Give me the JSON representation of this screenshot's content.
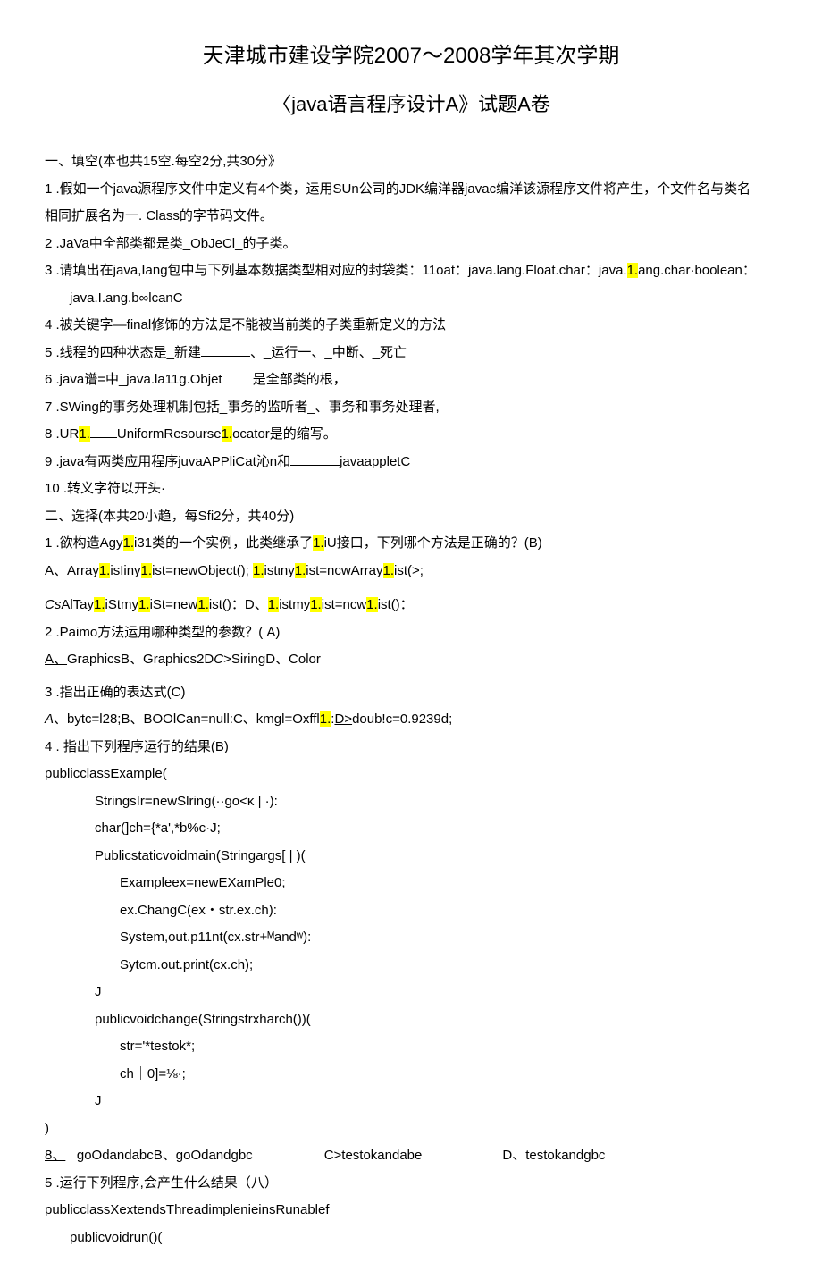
{
  "title1": "天津城市建设学院2007～2008学年其次学期",
  "title2": "〈java语言程序设计A》试题A卷",
  "sectionA": "一、填空(本也共15空.每空2分,共30分》",
  "q1a": "1 .假如一个java源程序文件中定义有4个类，运用SUn公司的JDK编洋器javac编洋该源程序文件将产生，个文件名与类名",
  "q1b": "相同扩展名为一. Class的字节码文件。",
  "q2": "2  .JaVa中全部类都是类_ObJeCl_的子类。",
  "q3a": "3  .请填出在java,Iang包中与下列基本数据类型相对应的封袋类：11oat：java.lang.Float.char：java.",
  "q3a_hl": "1.",
  "q3a_2": "ang.char·boolean：",
  "q3b": "java.I.ang.b∞lcanC",
  "q4": "4  .被关键字—final修饰的方法是不能被当前类的子类重新定义的方法",
  "q5": "5  .线程的四种状态是_新建",
  "q5b": "、_运行一、_中断、_死亡",
  "q6a": "6  .java谱=中_java.la11g.Objet  ",
  "q6b": "是全部类的根，",
  "q7": "7  .SWing的事务处理机制包括_事务的监听者_、事务和事务处理者,",
  "q8a": "8  .UR",
  "q8hl1": "1.",
  "q8b": "UniformResourse",
  "q8hl2": "1.",
  "q8c": "ocator是的缩写。",
  "q9a": "9  .java有两类应用程序juvaAPPliCat沁n和",
  "q9b": "javaappletC",
  "q10": "10   .转义字符以开头·",
  "sectionB": "二、选择(本共20小趋，每Sfi2分，共40分)",
  "b1a": "1 .欲构造Agy",
  "b1hl1": "1.",
  "b1b": "i31类的一个实例，此类继承了",
  "b1hl2": "1.",
  "b1c": "iU接口，下列哪个方法是正确的？(B)",
  "b1ansA": "A、Array",
  "b1ah1": "1.",
  "b1ansA2": "isIiny",
  "b1ah2": "1.",
  "b1ansA3": "ist=newObject(); ",
  "b1ah3": "1.",
  "b1ansA4": "istιny",
  "b1ah4": "1.",
  "b1ansA5": "ist=ncwArray",
  "b1ah5": "1.",
  "b1ansA6": "ist(>;",
  "b1ansC_pre": "Cs",
  "b1ansC1": "AlTay",
  "b1ch1": "1.",
  "b1ansC2": "iStmy",
  "b1ch2": "1.",
  "b1ansC3": "iSt=new",
  "b1ch3": "1.",
  "b1ansC4": "ist()：D、",
  "b1ch4": "1.",
  "b1ansC5": "istmy",
  "b1ch5": "1.",
  "b1ansC6": "ist=ncw",
  "b1ch6": "1.",
  "b1ansC7": "ist()：",
  "b2": "2  .Paimo方法运用哪种类型的参数？(       A)",
  "b2ans_a": "A、",
  "b2ans_b": "GraphicsB、Graphics2D",
  "b2ans_c": "C",
  "b2ans_d": ">SiringD、Color",
  "b3": "3  .指出正确的表达式(C)",
  "b3ans_a": "A",
  "b3ans_b": "、bytc=l28;B、BOOlCan=null:C、kmgl=Oxffl",
  "b3hl": "1.",
  "b3ans_c": ":",
  "b3ans_d": "D>",
  "b3ans_e": "doub!c=0.9239d;",
  "b4": "4  . 指出下列程序运行的结果(B)",
  "code1": "publicclassExample(",
  "code2": "StringsIr=newSlring(··go<κ | ·):",
  "code3": "char(]ch={*a',*b%c·J;",
  "code4": "Publicstaticvoidmain(Stringargs[ | )(",
  "code5": "Exampleex=newEXamPle0;",
  "code6": "ex.ChangC(ex・str.ex.ch):",
  "code7": "System,out.p11nt(cx.str+ᴹandʷ):",
  "code8": "Sytcm.out.print(cx.ch);",
  "code9": "J",
  "code10": "publicvoidchange(Stringstrxharch())(",
  "code11": "str='*testok*;",
  "code12": "ch｜0]=⅛·;",
  "code13": "J",
  "code14": ")",
  "b8a": "8、",
  "b8_1": "goOdandabcB、goOdandgbc",
  "b8_2": "C>testokandabe",
  "b8_3": "D、testokandgbc",
  "b5": "5   .运行下列程序,会产生什么结果（八）",
  "code15": "publicclassXextendsThreadimplenieinsRunablef",
  "code16": "publicvoidrun()("
}
